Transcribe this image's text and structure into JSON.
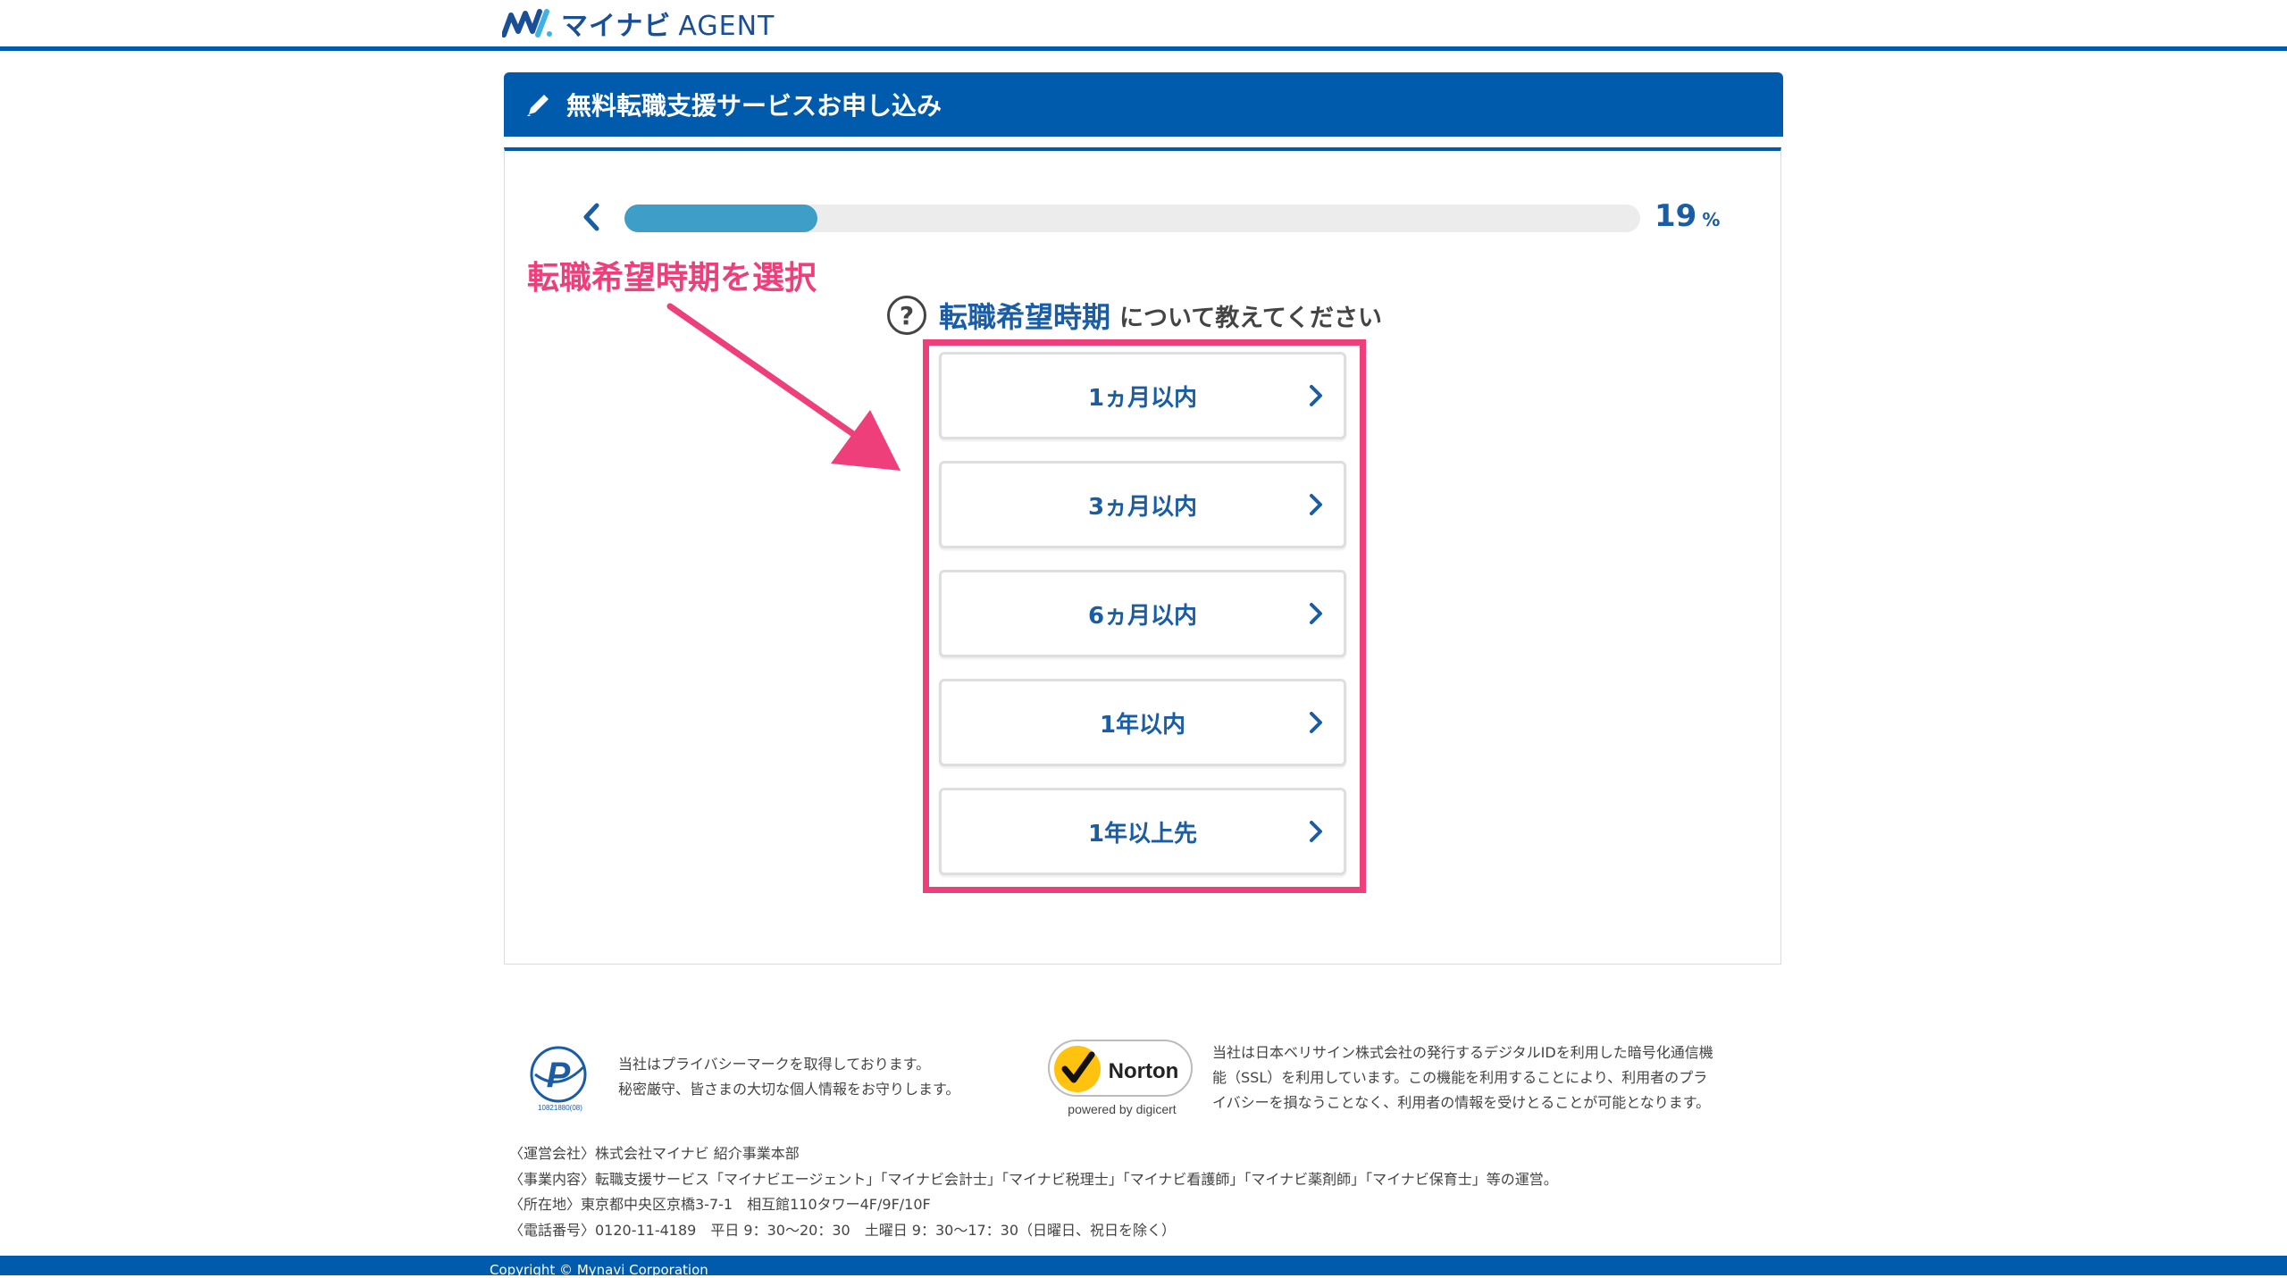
{
  "header": {
    "logo_text": "マイナビ",
    "logo_agent": "AGENT"
  },
  "title_bar": {
    "title": "無料転職支援サービスお申し込み"
  },
  "progress": {
    "percent": 19,
    "value_text": "19",
    "unit": "%",
    "fill_color": "#3f9ec7"
  },
  "annotation": {
    "label": "転職希望時期を選択",
    "color": "#ee3f7b"
  },
  "question": {
    "icon": "question-circle-icon",
    "icon_glyph": "?",
    "keyword": "転職希望時期",
    "rest": "について教えてください"
  },
  "options": [
    {
      "label": "1ヵ月以内"
    },
    {
      "label": "3ヵ月以内"
    },
    {
      "label": "6ヵ月以内"
    },
    {
      "label": "1年以内"
    },
    {
      "label": "1年以上先"
    }
  ],
  "footer": {
    "privacy_lines": [
      "当社はプライバシーマークを取得しております。",
      "秘密厳守、皆さまの大切な個人情報をお守りします。"
    ],
    "privacy_mark_number": "10821880(08)",
    "norton_brand": "Norton",
    "norton_powered": "powered by digicert",
    "ssl_lines": [
      "当社は日本ベリサイン株式会社の発行するデジタルIDを利用した暗号化通信機",
      "能（SSL）を利用しています。この機能を利用することにより、利用者のプラ",
      "イバシーを損なうことなく、利用者の情報を受けとることが可能となります。"
    ],
    "company_lines": [
      "〈運営会社〉株式会社マイナビ 紹介事業本部",
      "〈事業内容〉転職支援サービス「マイナビエージェント」「マイナビ会計士」「マイナビ税理士」「マイナビ看護師」「マイナビ薬剤師」「マイナビ保育士」等の運営。",
      "〈所在地〉東京都中央区京橋3-7-1　相互館110タワー4F/9F/10F",
      "〈電話番号〉0120-11-4189　平日 9：30〜20：30　土曜日 9：30〜17：30（日曜日、祝日を除く）"
    ],
    "copyright": "Copyright © Mynavi Corporation"
  },
  "colors": {
    "brand_blue": "#005bac",
    "text_blue": "#1a5da4",
    "highlight_pink": "#ee3f7b"
  }
}
